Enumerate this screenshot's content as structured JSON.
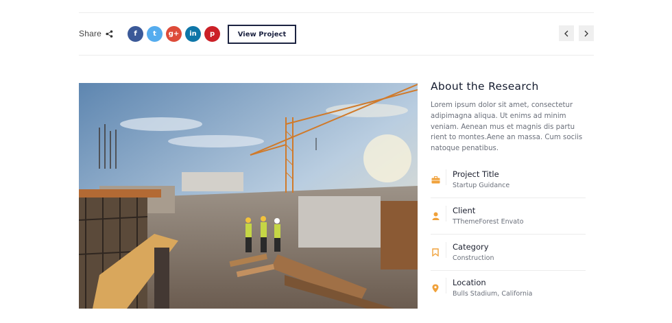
{
  "share": {
    "label": "Share"
  },
  "socials": [
    {
      "name": "facebook",
      "glyph": "f",
      "color": "#3b5998"
    },
    {
      "name": "twitter",
      "glyph": "t",
      "color": "#55acee"
    },
    {
      "name": "google-plus",
      "glyph": "g+",
      "color": "#dd4b39"
    },
    {
      "name": "linkedin",
      "glyph": "in",
      "color": "#0e76a8"
    },
    {
      "name": "pinterest",
      "glyph": "p",
      "color": "#cb2027"
    }
  ],
  "view_project": {
    "label": "View Project"
  },
  "nav": {
    "prev_icon": "chevron-left-icon",
    "next_icon": "chevron-right-icon"
  },
  "about": {
    "title": "About the Research",
    "description": "Lorem ipsum dolor sit amet, consectetur adipimagna aliqua. Ut enims ad minim veniam. Aenean mus et magnis dis partu rient to montes.Aene an massa. Cum sociis natoque penatibus."
  },
  "details": [
    {
      "icon": "briefcase-icon",
      "title": "Project Title",
      "value": "Startup Guidance"
    },
    {
      "icon": "user-icon",
      "title": "Client",
      "value": "TThemeForest Envato"
    },
    {
      "icon": "bookmark-icon",
      "title": "Category",
      "value": "Construction"
    },
    {
      "icon": "map-pin-icon",
      "title": "Location",
      "value": "Bulls Stadium, California"
    }
  ],
  "colors": {
    "accent": "#f0a13a",
    "dark": "#1b2240"
  }
}
